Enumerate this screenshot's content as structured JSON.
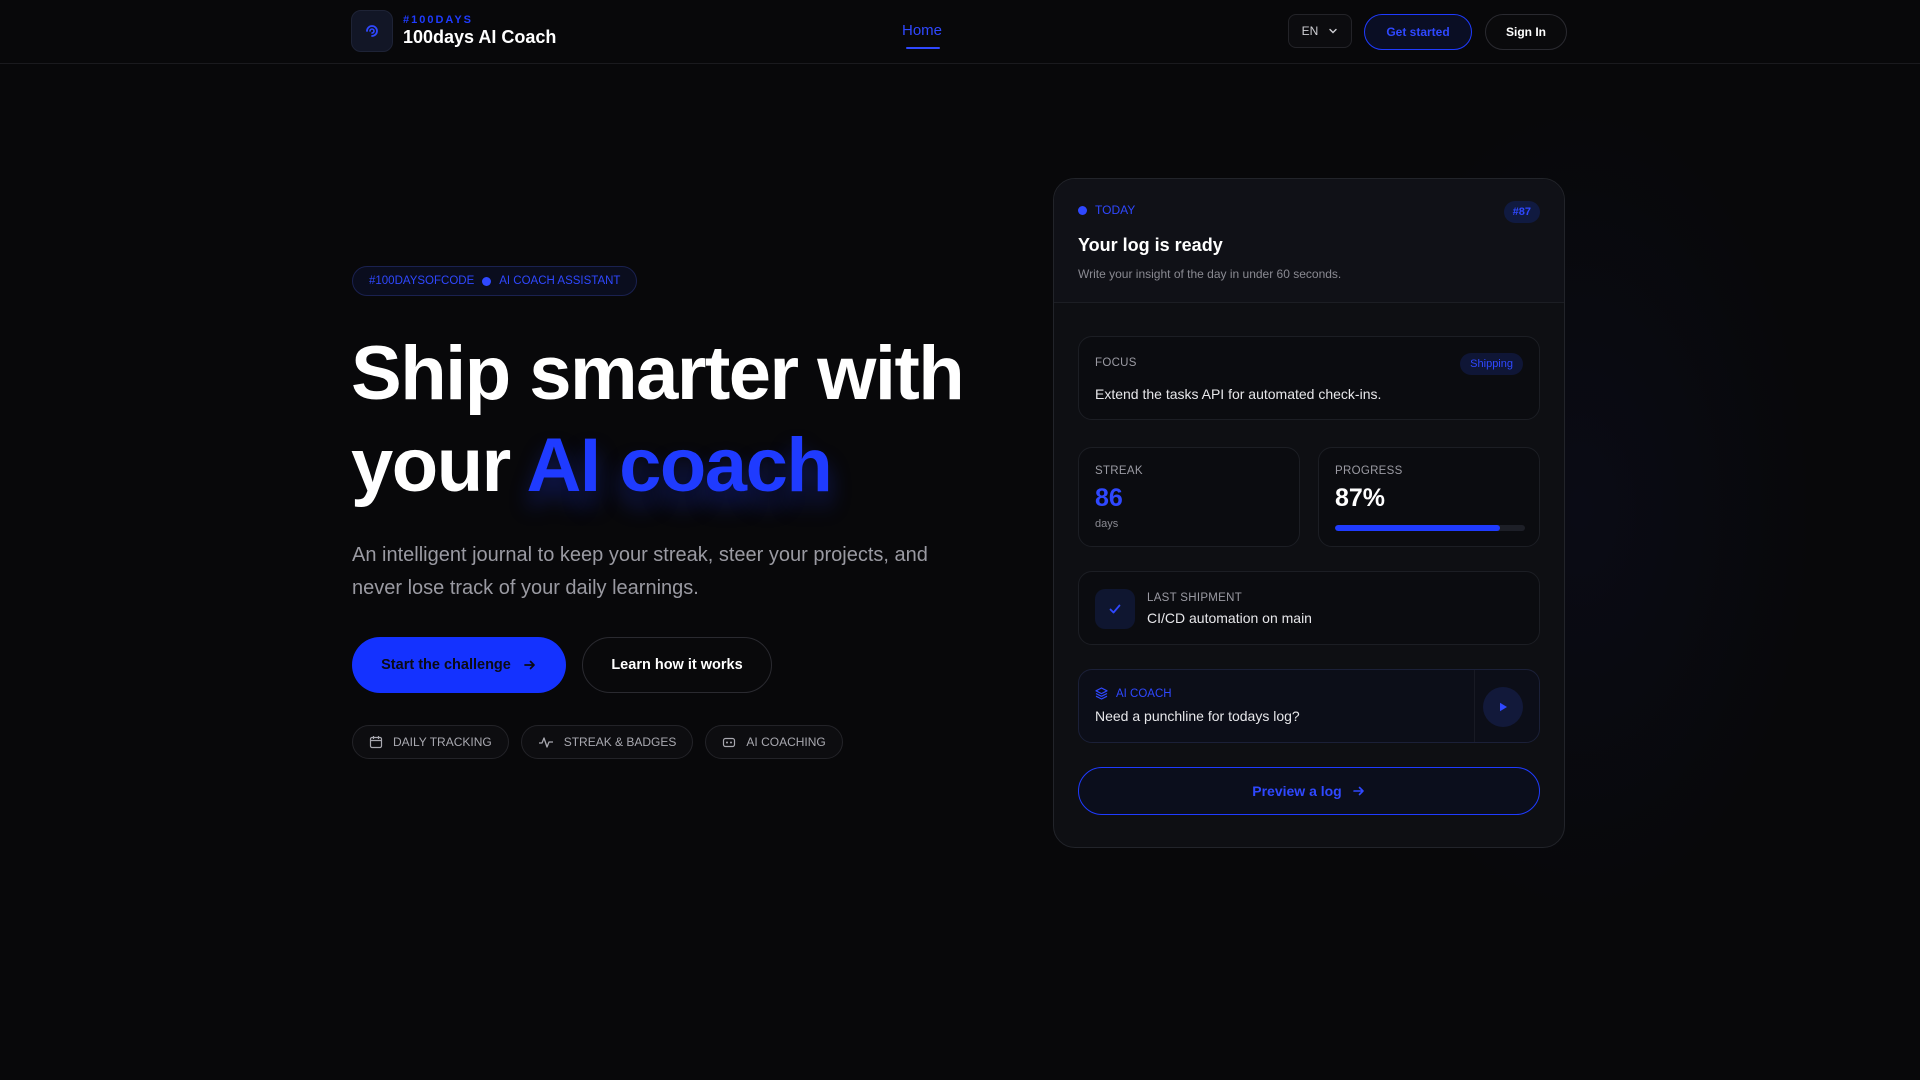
{
  "nav": {
    "brand_kicker": "#100DAYS",
    "brand_title": "100days AI Coach",
    "home_link": "Home",
    "language": "EN",
    "get_started": "Get started",
    "sign_in": "Sign In"
  },
  "hero": {
    "tag_left": "#100DAYSOFCODE",
    "tag_right": "AI COACH ASSISTANT",
    "headline_line1": "Ship smarter with",
    "headline_line2_prefix": "your",
    "headline_accent": "AI coach",
    "subtitle": "An intelligent journal to keep your streak, steer your projects, and never lose track of your daily learnings.",
    "primary_cta": "Start the challenge",
    "secondary_cta": "Learn how it works",
    "chips": [
      "DAILY TRACKING",
      "STREAK & BADGES",
      "AI COACHING"
    ]
  },
  "card": {
    "today_label": "TODAY",
    "day_badge": "#87",
    "title": "Your log is ready",
    "subtitle": "Write your insight of the day in under 60 seconds.",
    "focus_label": "FOCUS",
    "focus_badge": "Shipping",
    "focus_text": "Extend the tasks API for automated check-ins.",
    "streak_label": "STREAK",
    "streak_value": "86",
    "streak_unit": "days",
    "progress_label": "PROGRESS",
    "progress_value": "87%",
    "progress_fraction": 0.87,
    "shipment_label": "LAST SHIPMENT",
    "shipment_text": "CI/CD automation on main",
    "coach_label": "AI COACH",
    "coach_text": "Need a punchline for todays log?",
    "preview_button": "Preview a log"
  },
  "colors": {
    "accent": "#1f3bff",
    "background": "#08080a"
  },
  "icons": {
    "brand": "logo-swirl-icon",
    "lang": "chevron-down-icon",
    "cta": "arrow-right-icon",
    "chips": [
      "calendar-icon",
      "sparkline-icon",
      "robot-icon"
    ],
    "shipment": "check-icon",
    "coach": "layers-icon",
    "play": "play-icon"
  }
}
